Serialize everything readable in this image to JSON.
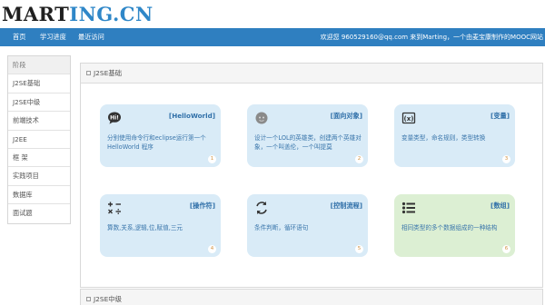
{
  "logo": {
    "part1": "MART",
    "part2": "ING.CN"
  },
  "nav": {
    "items": [
      "首页",
      "学习进度",
      "最近访问"
    ],
    "welcome": "欢迎您 960529160@qq.com 来到Marting，一个由麦宝康制作的MOOC网站"
  },
  "sidebar": {
    "header": "阶段",
    "items": [
      "J2SE基础",
      "J2SE中级",
      "前端技术",
      "J2EE",
      "框 架",
      "实践项目",
      "数据库",
      "面试题"
    ]
  },
  "panels": [
    {
      "title": "J2SE基础"
    },
    {
      "title": "J2SE中级"
    }
  ],
  "cards": [
    {
      "title": "[HelloWorld]",
      "desc": "分别使用命令行和eclipse运行第一个HelloWorld 程序",
      "num": "1",
      "icon": "hi-chat-icon"
    },
    {
      "title": "[面向对象]",
      "desc": "设计一个LOL的英雄类，创建两个英雄对象，一个叫盖伦，一个叫提莫",
      "num": "2",
      "icon": "hero-avatar-icon"
    },
    {
      "title": "[变量]",
      "desc": "变量类型，命名规则，类型转换",
      "num": "3",
      "icon": "variable-x-icon"
    },
    {
      "title": "[操作符]",
      "desc": "算数,关系,逻辑,位,赋值,三元",
      "num": "4",
      "icon": "calculator-icon"
    },
    {
      "title": "[控制流程]",
      "desc": "条件判断，循环语句",
      "num": "5",
      "icon": "refresh-arrows-icon"
    },
    {
      "title": "[数组]",
      "desc": "相同类型的多个数据组成的一种结构",
      "num": "6",
      "icon": "list-icon"
    }
  ],
  "colors": {
    "navbar": "#2f7fc0",
    "logo_accent": "#2f87c8",
    "card_blue": "#d9ebf7",
    "card_green": "#dcefd3",
    "card_title": "#2f6fa8",
    "badge_number": "#d09040"
  }
}
